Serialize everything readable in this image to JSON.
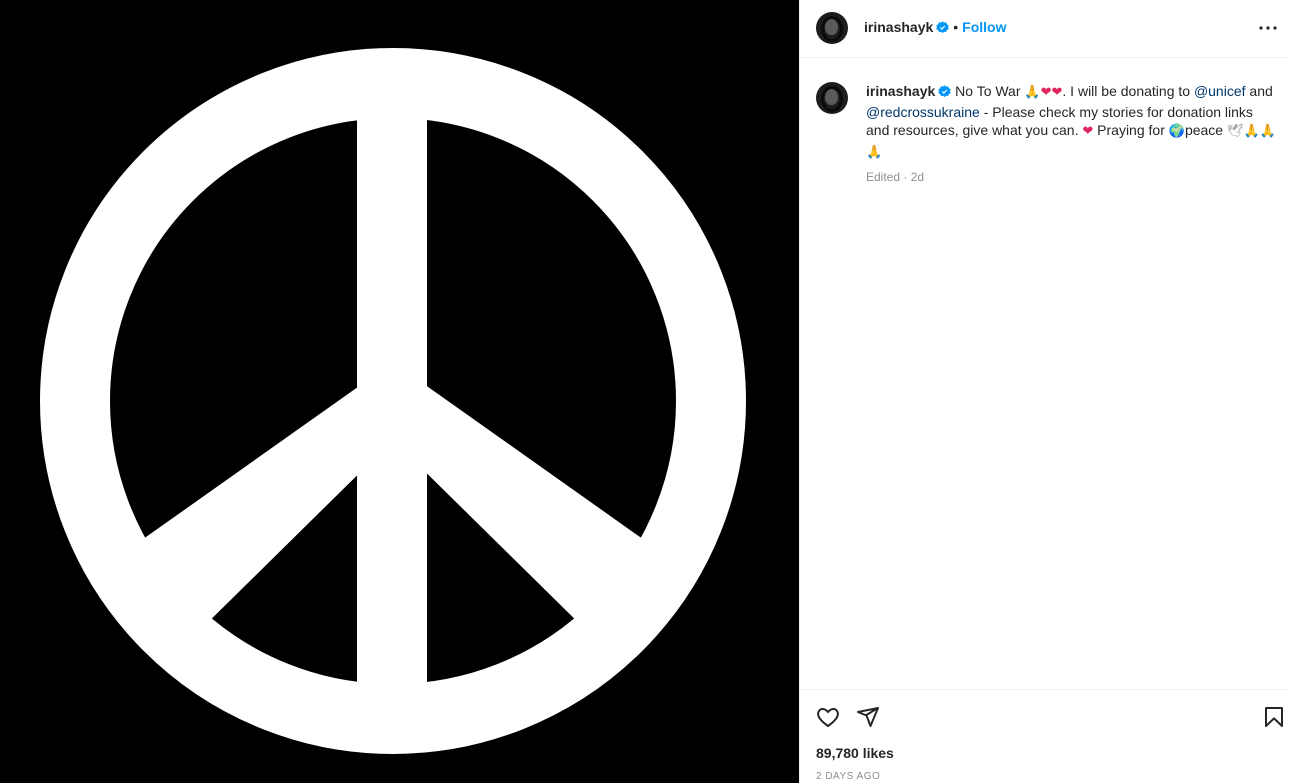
{
  "post": {
    "username": "irinashayk",
    "verified": true,
    "follow_label": "Follow",
    "separator": "•"
  },
  "caption": {
    "username": "irinashayk",
    "segments": {
      "s1": "No To War",
      "s2": ". I will be donating to",
      "m1": "@unicef",
      "s3": "and",
      "m2": "@redcrossukraine",
      "s4": "- Please check my stories for donation links and resources, give what you can.",
      "s5": "Praying for",
      "s6": "peace"
    },
    "emojis": {
      "pray": "🙏",
      "heart": "❤",
      "globe": "🌍",
      "dove": "🕊"
    },
    "edited_label": "Edited · 2d"
  },
  "actions": {
    "likes": "89,780 likes",
    "date": "2 DAYS AGO"
  },
  "media": {
    "description": "peace-symbol",
    "background": "#000000",
    "symbol_color": "#ffffff"
  },
  "colors": {
    "accent": "#0095f6",
    "mention": "#00376b",
    "muted": "#8e8e8e",
    "border": "#efefef"
  }
}
